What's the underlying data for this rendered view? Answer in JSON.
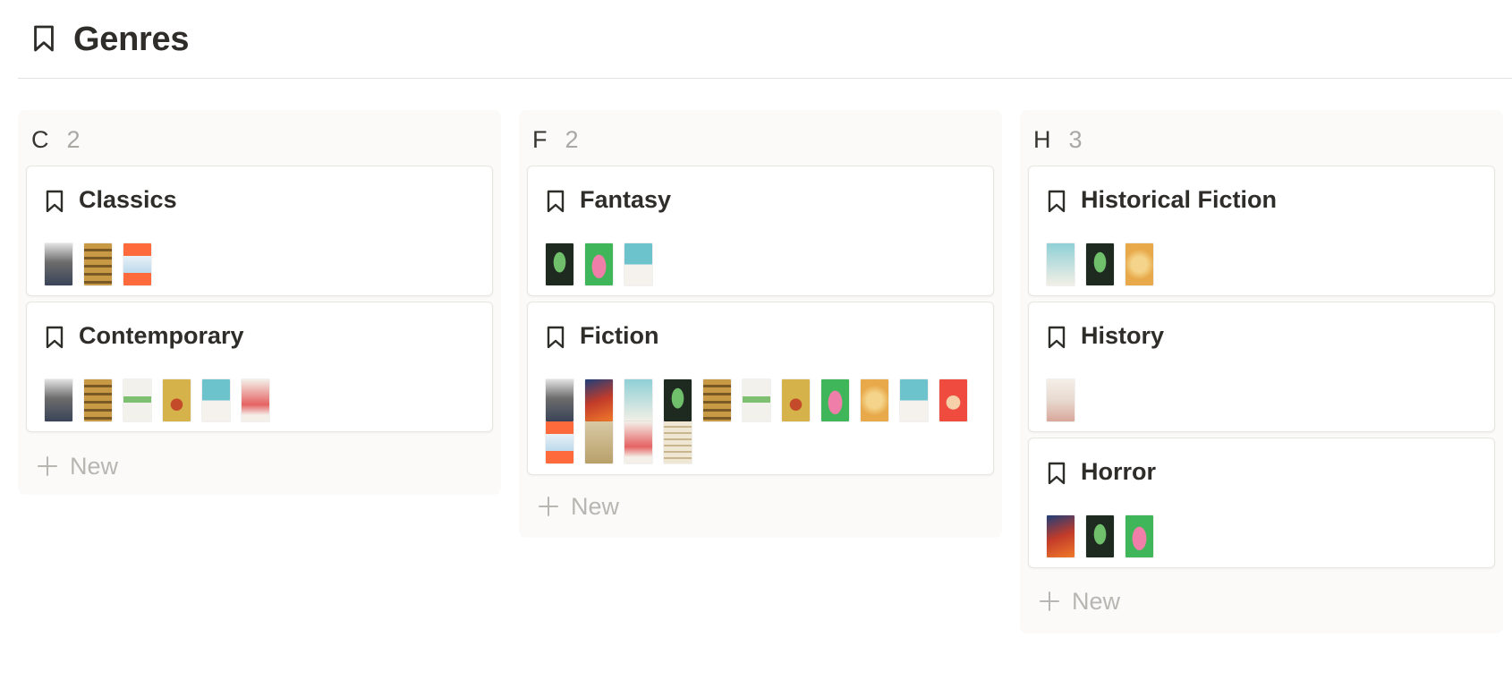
{
  "page": {
    "title": "Genres",
    "icon": "bookmark-icon"
  },
  "colors": {
    "accent_text": "#37352f",
    "muted": "#aaa8a3",
    "column_bg": "#fbfaf9",
    "card_border": "#e6e5e2"
  },
  "board": {
    "new_label": "New",
    "columns": [
      {
        "name": "C",
        "count": "2",
        "cards": [
          {
            "title": "Classics",
            "covers": [
              "c1",
              "c2",
              "c3"
            ]
          },
          {
            "title": "Contemporary",
            "covers": [
              "c1",
              "c2",
              "c7",
              "c8",
              "c6",
              "c9"
            ]
          }
        ]
      },
      {
        "name": "F",
        "count": "2",
        "cards": [
          {
            "title": "Fantasy",
            "covers": [
              "c4",
              "c5",
              "c6"
            ]
          },
          {
            "title": "Fiction",
            "covers": [
              "c1",
              "c10",
              "c11",
              "c4",
              "c2",
              "c7",
              "c8",
              "c5",
              "c12",
              "c6",
              "c13",
              "c3",
              "c14",
              "c9",
              "c15"
            ]
          }
        ]
      },
      {
        "name": "H",
        "count": "3",
        "cards": [
          {
            "title": "Historical Fiction",
            "covers": [
              "c11",
              "c4",
              "c12"
            ]
          },
          {
            "title": "History",
            "covers": [
              "c16"
            ]
          },
          {
            "title": "Horror",
            "covers": [
              "c10",
              "c4",
              "c5"
            ]
          }
        ]
      }
    ]
  }
}
